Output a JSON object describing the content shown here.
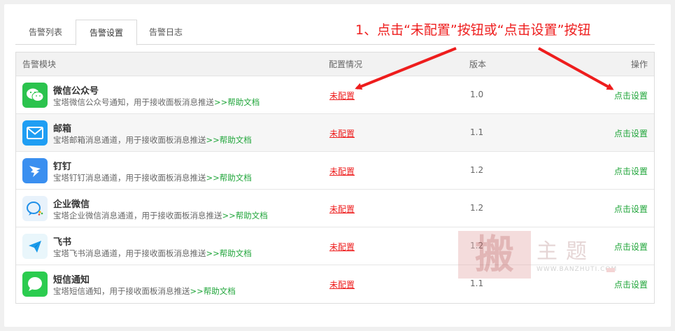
{
  "tabs": [
    "告警列表",
    "告警设置",
    "告警日志"
  ],
  "active_tab": 1,
  "annotation": "1、点击“未配置”按钮或“点击设置”按钮",
  "table": {
    "headers": {
      "module": "告警模块",
      "config": "配置情况",
      "version": "版本",
      "action": "操作"
    },
    "rows": [
      {
        "name": "微信公众号",
        "desc": "宝塔微信公众号通知，用于接收面板消息推送",
        "help": ">>帮助文档",
        "status": "未配置",
        "version": "1.0",
        "action": "点击设置",
        "icon": "wechat-icon",
        "icon_color": "#2bc34d"
      },
      {
        "name": "邮箱",
        "desc": "宝塔邮箱消息通道，用于接收面板消息推送",
        "help": ">>帮助文档",
        "status": "未配置",
        "version": "1.1",
        "action": "点击设置",
        "icon": "mail-icon",
        "icon_color": "#1f9ef3"
      },
      {
        "name": "钉钉",
        "desc": "宝塔钉钉消息通道，用于接收面板消息推送",
        "help": ">>帮助文档",
        "status": "未配置",
        "version": "1.2",
        "action": "点击设置",
        "icon": "dingtalk-icon",
        "icon_color": "#3a8ff0"
      },
      {
        "name": "企业微信",
        "desc": "宝塔企业微信消息通道，用于接收面板消息推送",
        "help": ">>帮助文档",
        "status": "未配置",
        "version": "1.2",
        "action": "点击设置",
        "icon": "wecom-icon",
        "icon_color": "#e8f2fb"
      },
      {
        "name": "飞书",
        "desc": "宝塔飞书消息通道，用于接收面板消息推送",
        "help": ">>帮助文档",
        "status": "未配置",
        "version": "1.2",
        "action": "点击设置",
        "icon": "feishu-icon",
        "icon_color": "#e9f6fb"
      },
      {
        "name": "短信通知",
        "desc": "宝塔短信通知，用于接收面板消息推送",
        "help": ">>帮助文档",
        "status": "未配置",
        "version": "1.1",
        "action": "点击设置",
        "icon": "sms-icon",
        "icon_color": "#2bcc4f"
      }
    ]
  },
  "watermark": {
    "stamp": "搬",
    "text": "主题",
    "url": "WWW.BANZHUTI.COM"
  },
  "colors": {
    "accent_green": "#20a53a",
    "alert_red": "#ee1d1d"
  }
}
